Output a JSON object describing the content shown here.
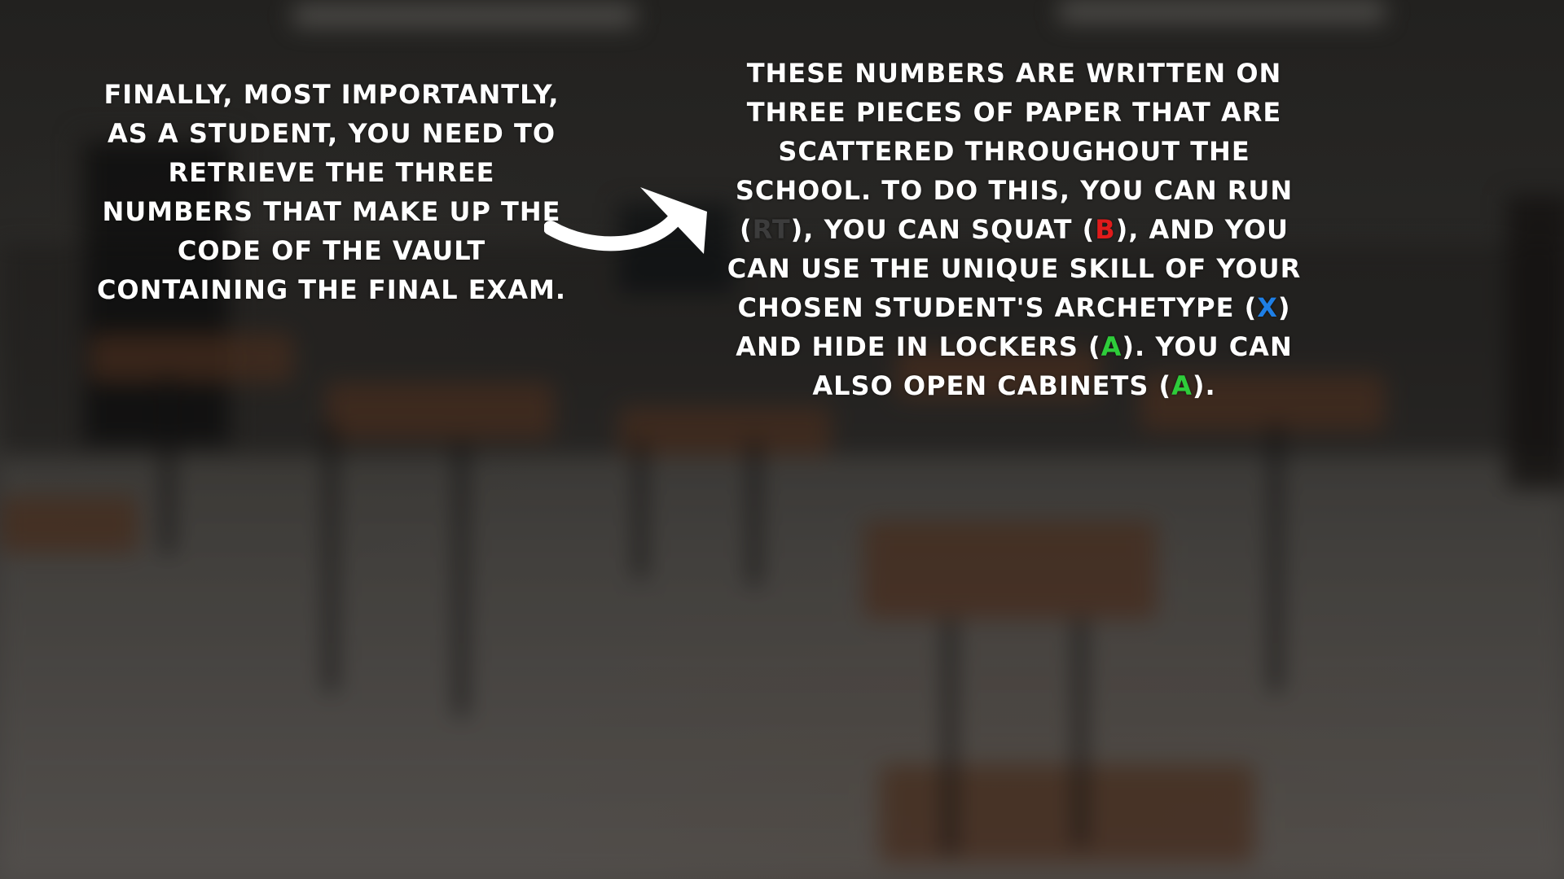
{
  "left_panel": {
    "text": "Finally, most importantly, as a student, you need to retrieve the three numbers that make up the code of the vault containing the final exam."
  },
  "right_panel": {
    "line1": "These numbers are written on three pieces of paper that are scattered throughout the school. To do this, you can run (",
    "key_run": "RT",
    "line2": "), you can squat (",
    "key_squat": "B",
    "line3": "), and you can use the unique skill of your chosen student's archetype (",
    "key_skill": "X",
    "line4": ") and hide in lockers (",
    "key_hide": "A",
    "line5": "). You can also open cabinets (",
    "key_open": "A",
    "line6": ")."
  },
  "colors": {
    "key_rt": "#3c3c3c",
    "key_b": "#e01b1b",
    "key_x": "#1e7fe6",
    "key_a": "#2ecc3a",
    "text": "#ffffff"
  },
  "icons": {
    "arrow": "curved-arrow-right-icon"
  }
}
